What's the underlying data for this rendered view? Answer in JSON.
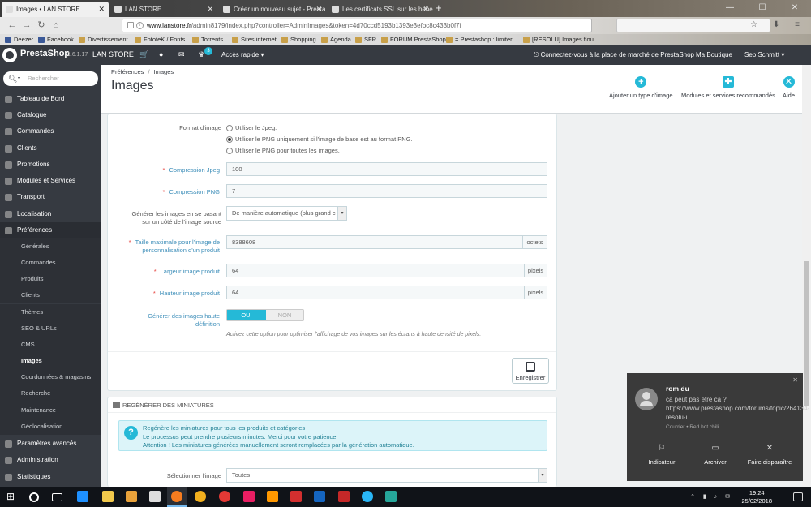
{
  "browser": {
    "tabs": [
      {
        "label": "Images • LAN STORE",
        "active": true
      },
      {
        "label": "LAN STORE"
      },
      {
        "label": "Créer un nouveau sujet - Presta"
      },
      {
        "label": "Les certificats SSL sur les heber"
      }
    ],
    "url_host": "www.lanstore.fr",
    "url_path": "/admin8179/index.php?controller=AdminImages&token=4d70ccd5193b1393e3efbc8c433b0f7f",
    "bookmarks": [
      "Deezer",
      "Facebook",
      "Divertissement",
      "FototeK / Fonts",
      "Torrents",
      "Sites internet",
      "Shopping",
      "Agenda",
      "SFR",
      "FORUM PrestaShop",
      "= Prestashop : limiter ...",
      "[RESOLU] Images flou..."
    ]
  },
  "header": {
    "brand": "PrestaShop",
    "version": "1.6.1.17",
    "shop": "LAN STORE",
    "notif_count": "3",
    "quick_access": "Accès rapide",
    "marketplace": "Connectez-vous à la place de marché de PrestaShop",
    "my_shop": "Ma Boutique",
    "user": "Seb Schmitt"
  },
  "sidebar": {
    "search_placeholder": "Rechercher",
    "items": [
      "Tableau de Bord",
      "Catalogue",
      "Commandes",
      "Clients",
      "Promotions",
      "Modules et Services",
      "Transport",
      "Localisation",
      "Préférences"
    ],
    "subitems": [
      "Générales",
      "Commandes",
      "Produits",
      "Clients",
      "Thèmes",
      "SEO & URLs",
      "CMS",
      "Images",
      "Coordonnées & magasins",
      "Recherche",
      "Maintenance",
      "Géolocalisation"
    ],
    "bottom_items": [
      "Paramètres avancés",
      "Administration",
      "Statistiques"
    ]
  },
  "page": {
    "breadcrumb": [
      "Préférences",
      "Images"
    ],
    "title": "Images",
    "toolbar": [
      "Ajouter un type d'image",
      "Modules et services recommandés",
      "Aide"
    ]
  },
  "form": {
    "format_label": "Format d'image",
    "format_options": [
      "Utiliser le Jpeg.",
      "Utiliser le PNG uniquement si l'image de base est au format PNG.",
      "Utiliser le PNG pour toutes les images."
    ],
    "jpeg_label": "Compression Jpeg",
    "jpeg_value": "100",
    "png_label": "Compression PNG",
    "png_value": "7",
    "gen_label_1": "Générer les images en se basant",
    "gen_label_2": "sur un côté de l'image source",
    "gen_value": "De manière automatique (plus grand c",
    "maxsize_label_1": "Taille maximale pour l'image de",
    "maxsize_label_2": "personnalisation d'un produit",
    "maxsize_value": "8388608",
    "maxsize_unit": "octets",
    "width_label": "Largeur image produit",
    "width_value": "64",
    "height_label": "Hauteur image produit",
    "height_value": "64",
    "px_unit": "pixels",
    "hd_label_1": "Générer des images haute",
    "hd_label_2": "définition",
    "yes": "OUI",
    "no": "NON",
    "hd_help": "Activez cette option pour optimiser l'affichage de vos images sur les écrans à haute densité de pixels.",
    "save": "Enregistrer"
  },
  "regen": {
    "title": "Regénérer des miniatures",
    "alert_1": "Regénère les miniatures pour tous les produits et catégories",
    "alert_2": "Le processus peut prendre plusieurs minutes. Merci pour votre patience.",
    "alert_3": "Attention ! Les miniatures générées manuellement seront remplacées par la génération automatique.",
    "select_label": "Sélectionner l'image",
    "select_value": "Toutes"
  },
  "notification": {
    "title": "rom du",
    "body": "ca peut pas etre ca ?     https://www.prestashop.com/forums/topic/264134-resolu-i",
    "source": "Courrier • Red hot chili",
    "actions": [
      "Indicateur",
      "Archiver",
      "Faire disparaître"
    ]
  },
  "taskbar": {
    "time": "19:24",
    "date": "25/02/2018"
  }
}
